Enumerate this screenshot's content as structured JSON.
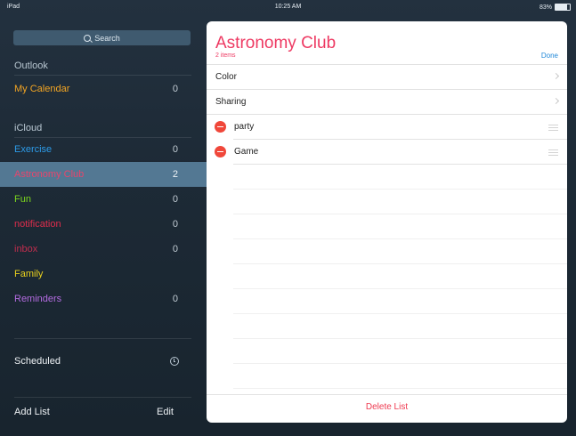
{
  "status": {
    "device": "iPad",
    "time": "10:25 AM",
    "battery": "83%",
    "battery_level": 0.83
  },
  "sidebar": {
    "search_label": "Search",
    "groups": [
      {
        "header": "Outlook"
      },
      {
        "header": "iCloud"
      }
    ],
    "lists": [
      {
        "label": "My Calendar",
        "count": "0",
        "color": "#f4a623"
      },
      {
        "label": "Exercise",
        "count": "0",
        "color": "#2d9be8"
      },
      {
        "label": "Astronomy Club",
        "count": "2",
        "color": "#e8456c"
      },
      {
        "label": "Fun",
        "count": "0",
        "color": "#7cd81e"
      },
      {
        "label": "notification",
        "count": "0",
        "color": "#e02d4c"
      },
      {
        "label": "inbox",
        "count": "0",
        "color": "#c22d4e"
      },
      {
        "label": "Family",
        "count": "",
        "color": "#e8d01e"
      },
      {
        "label": "Reminders",
        "count": "0",
        "color": "#b36be0"
      }
    ],
    "scheduled_label": "Scheduled",
    "add_list_label": "Add List",
    "edit_label": "Edit"
  },
  "detail": {
    "title": "Astronomy Club",
    "items_count": "2 items",
    "done_label": "Done",
    "color_label": "Color",
    "sharing_label": "Sharing",
    "items": [
      {
        "label": "party"
      },
      {
        "label": "Game"
      }
    ],
    "delete_label": "Delete List"
  }
}
